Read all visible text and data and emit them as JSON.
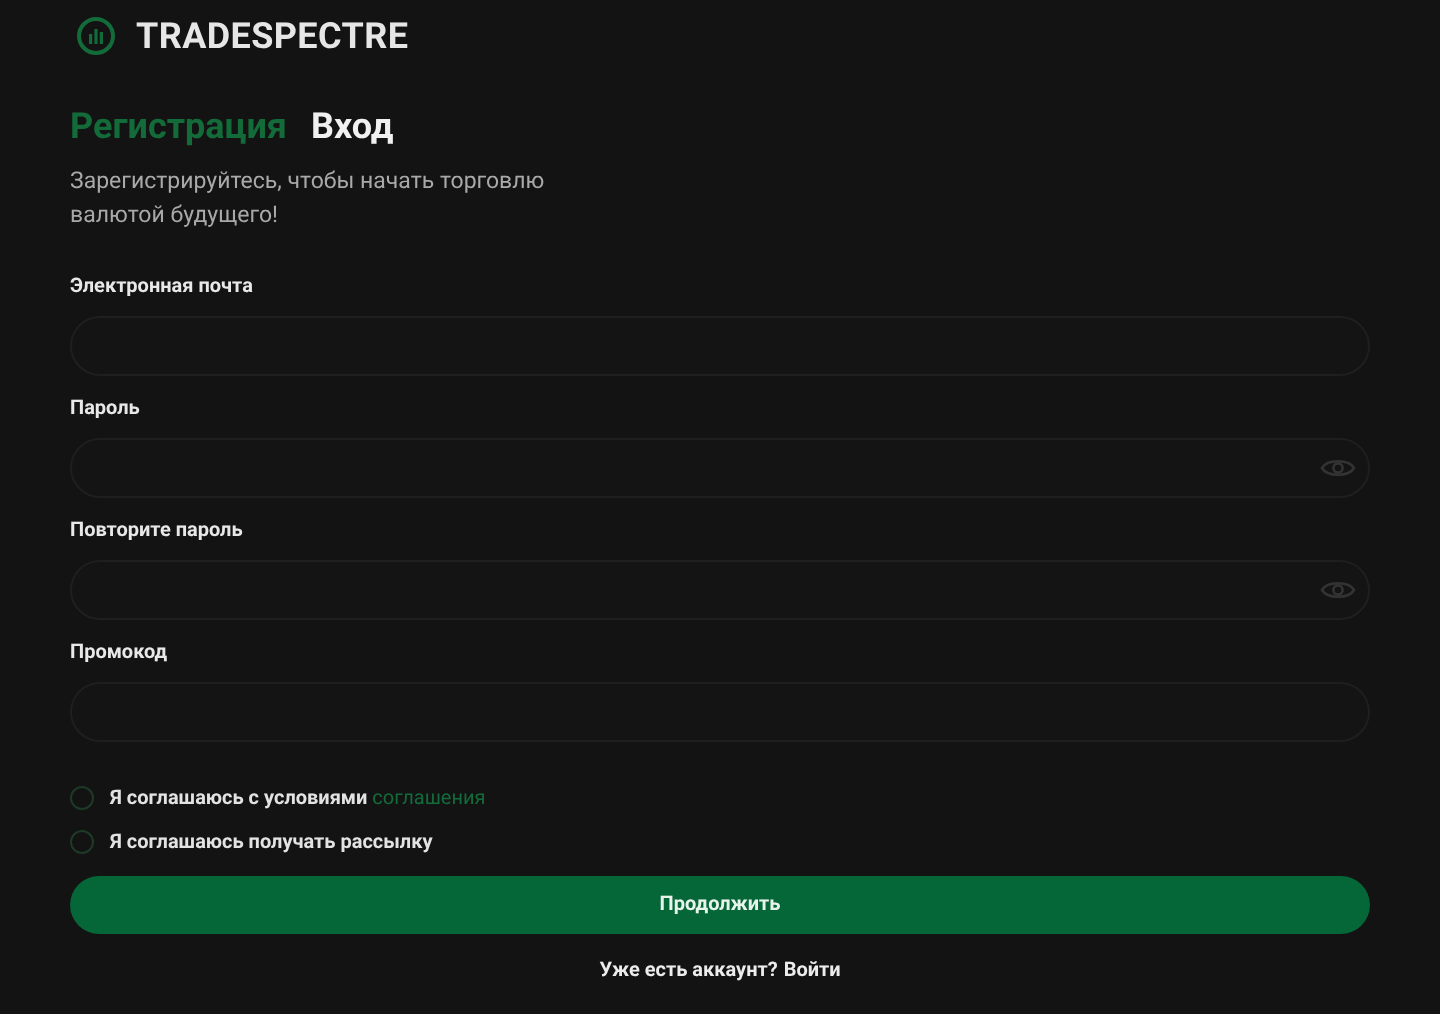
{
  "brand": {
    "name": "TRADESPECTRE"
  },
  "tabs": [
    {
      "label": "Регистрация",
      "selected": true
    },
    {
      "label": "Вход",
      "selected": false
    }
  ],
  "subtitle": "Зарегистрируйтесь, чтобы начать торговлю валютой будущего!",
  "fields": [
    {
      "label": "Электронная почта",
      "kind": "text"
    },
    {
      "label": "Пароль",
      "kind": "password"
    },
    {
      "label": "Повторите пароль",
      "kind": "password"
    },
    {
      "label": "Промокод",
      "kind": "text"
    }
  ],
  "checkboxes": [
    {
      "text": "Я соглашаюсь с условиями",
      "link": "соглашения",
      "checked": false
    },
    {
      "text": "Я соглашаюсь получать рассылку",
      "checked": false
    }
  ],
  "submit": "Продолжить",
  "footer": {
    "text": "Уже есть аккаунт?",
    "link": "Войти"
  }
}
